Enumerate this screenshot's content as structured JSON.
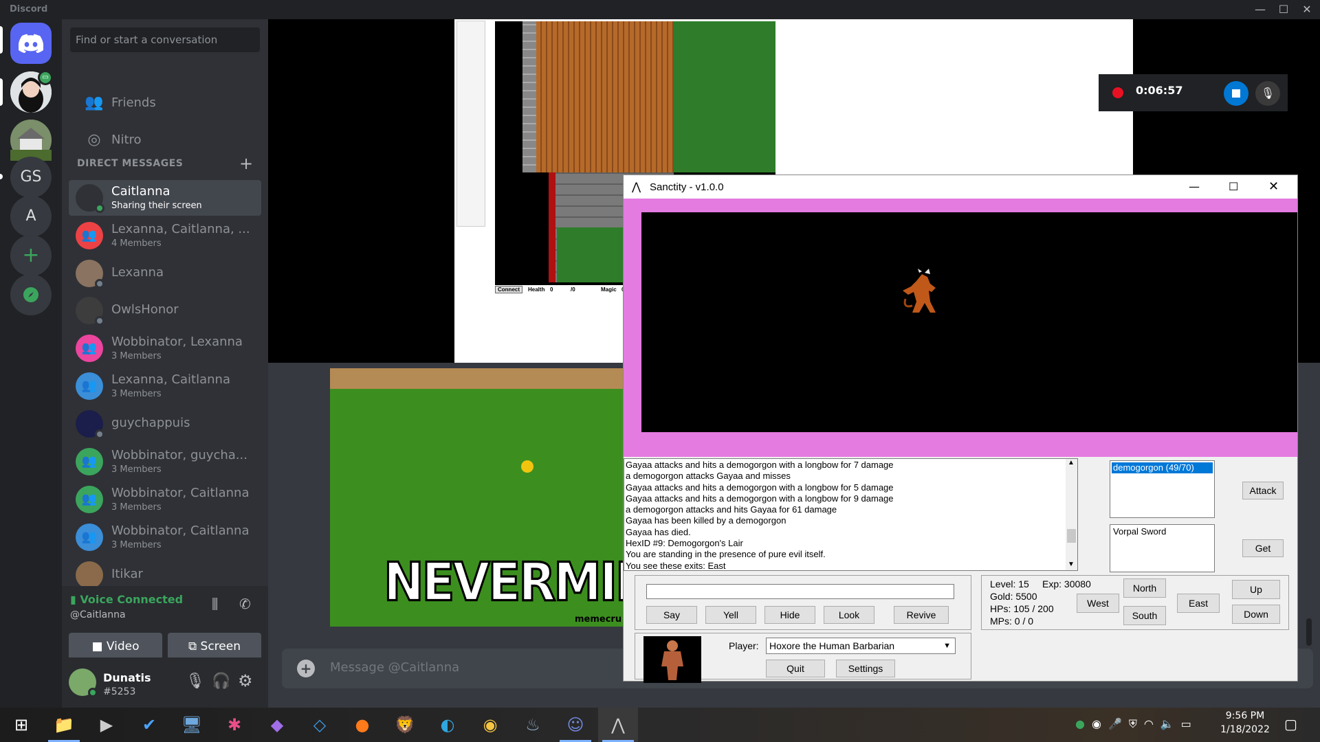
{
  "window": {
    "app_name": "Discord",
    "minimize": "—",
    "maximize": "☐",
    "close": "✕"
  },
  "servers": [
    {
      "label": "",
      "icon": "discord-logo-icon",
      "color": "#5865f2"
    },
    {
      "label": "",
      "icon": "avatar-icon",
      "color": "#2f3136"
    },
    {
      "label": "",
      "icon": "house-image-icon",
      "color": "#556b4f"
    },
    {
      "label": "GS",
      "icon": "",
      "color": "#36393f"
    },
    {
      "label": "A",
      "icon": "",
      "color": "#36393f"
    },
    {
      "label": "+",
      "icon": "add-server-icon",
      "color": "#36393f"
    },
    {
      "label": "",
      "icon": "compass-icon",
      "color": "#36393f"
    }
  ],
  "sidebar": {
    "search_placeholder": "Find or start a conversation",
    "friends": "Friends",
    "nitro": "Nitro",
    "dm_header": "DIRECT MESSAGES",
    "dm_add": "+",
    "dms": [
      {
        "name": "Caitlanna",
        "sub": "Sharing their screen",
        "color": "#2f3136",
        "status": "#3ba55d",
        "selected": true
      },
      {
        "name": "Lexanna, Caitlanna, ...",
        "sub": "4 Members",
        "color": "#ed4245"
      },
      {
        "name": "Lexanna",
        "sub": "",
        "color": "#8a7360",
        "status": "#747f8d"
      },
      {
        "name": "OwlsHonor",
        "sub": "",
        "color": "#3d3d3d",
        "status": "#747f8d"
      },
      {
        "name": "Wobbinator, Lexanna",
        "sub": "3 Members",
        "color": "#eb459e"
      },
      {
        "name": "Lexanna, Caitlanna",
        "sub": "3 Members",
        "color": "#3b8ed8"
      },
      {
        "name": "guychappuis",
        "sub": "",
        "color": "#1b1e4a",
        "status": "#747f8d"
      },
      {
        "name": "Wobbinator, guycha...",
        "sub": "3 Members",
        "color": "#3ba55d"
      },
      {
        "name": "Wobbinator, Caitlanna",
        "sub": "3 Members",
        "color": "#3ba55d"
      },
      {
        "name": "Wobbinator, Caitlanna",
        "sub": "3 Members",
        "color": "#3b8ed8"
      },
      {
        "name": "Itikar",
        "sub": "",
        "color": "#8a6a4a"
      }
    ],
    "voice": {
      "status": "Voice Connected",
      "channel": "@Caitlanna",
      "video": "Video",
      "screen": "Screen"
    },
    "profile": {
      "name": "Dunatis",
      "tag": "#5253"
    }
  },
  "recorder": {
    "time": "0:06:57"
  },
  "meme": {
    "caption": "NEVERMIND",
    "watermark": "memecru"
  },
  "shared_game": {
    "connect": "Connect",
    "health": "Health",
    "health_val": "0",
    "health_max": "/0",
    "magic": "Magic",
    "magic_val": "0"
  },
  "message": {
    "placeholder": "Message @Caitlanna"
  },
  "sanctity": {
    "title": "Sanctity - v1.0.0",
    "log": [
      "Gayaa attacks and hits a demogorgon with a longbow for 7 damage",
      "a demogorgon attacks Gayaa and misses",
      "Gayaa attacks and hits a demogorgon with a longbow for 5 damage",
      "Gayaa attacks and hits a demogorgon with a longbow for 9 damage",
      "a demogorgon attacks and hits Gayaa for 61 damage",
      "Gayaa has been killed by a demogorgon",
      "Gayaa has died.",
      "HexID #9: Demogorgon's Lair",
      "You are standing in the presence of pure evil itself.",
      "You see these exits:  East"
    ],
    "monsters": [
      "demogorgon (49/70)"
    ],
    "items": [
      "Vorpal Sword"
    ],
    "buttons": {
      "attack": "Attack",
      "get": "Get",
      "say": "Say",
      "yell": "Yell",
      "hide": "Hide",
      "look": "Look",
      "revive": "Revive",
      "quit": "Quit",
      "settings": "Settings",
      "north": "North",
      "south": "South",
      "east": "East",
      "west": "West",
      "up": "Up",
      "down": "Down"
    },
    "stats": {
      "level": "Level: 15",
      "exp": "Exp: 30080",
      "gold": "Gold: 5500",
      "hps": "HPs: 105 / 200",
      "mps": "MPs: 0 / 0"
    },
    "player_label": "Player:",
    "player": "Hoxore the Human Barbarian",
    "input_value": ""
  },
  "taskbar": {
    "icons": [
      "windows-start-icon",
      "file-explorer-icon",
      "terminal-icon",
      "todo-icon",
      "remote-desktop-icon",
      "slack-icon",
      "visual-studio-icon",
      "vscode-icon",
      "firefox-icon",
      "brave-icon",
      "edge-icon",
      "chrome-icon",
      "steam-icon",
      "discord-icon",
      "sanctity-icon"
    ],
    "time": "9:56 PM",
    "date": "1/18/2022"
  }
}
